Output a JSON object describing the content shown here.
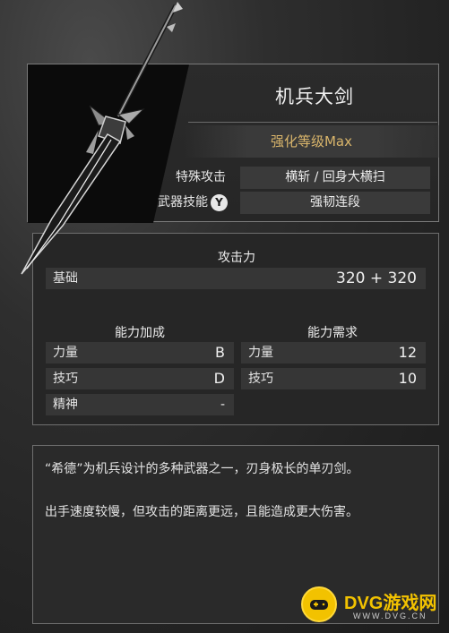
{
  "weapon": {
    "name": "机兵大剑",
    "upgrade": "强化等级Max",
    "special_attack_label": "特殊攻击",
    "special_attack_value": "横斩 / 回身大横扫",
    "weapon_skill_label": "武器技能",
    "weapon_skill_button": "Y",
    "weapon_skill_value": "强韧连段"
  },
  "attack": {
    "header": "攻击力",
    "base_label": "基础",
    "base_value": "320 + 320"
  },
  "bonus": {
    "header": "能力加成",
    "rows": [
      {
        "label": "力量",
        "value": "B"
      },
      {
        "label": "技巧",
        "value": "D"
      },
      {
        "label": "精神",
        "value": "-"
      }
    ]
  },
  "requirement": {
    "header": "能力需求",
    "rows": [
      {
        "label": "力量",
        "value": "12"
      },
      {
        "label": "技巧",
        "value": "10"
      }
    ]
  },
  "description": {
    "line1": "“希德”为机兵设计的多种武器之一，刃身极长的单刃剑。",
    "line2": "出手速度较慢，但攻击的距离更远，且能造成更大伤害。"
  },
  "watermark": {
    "brand": "DVG游戏网",
    "url": "WWW.DVG.CN"
  },
  "colors": {
    "accent_gold": "#d9b56b",
    "logo_yellow": "#f2c200"
  }
}
